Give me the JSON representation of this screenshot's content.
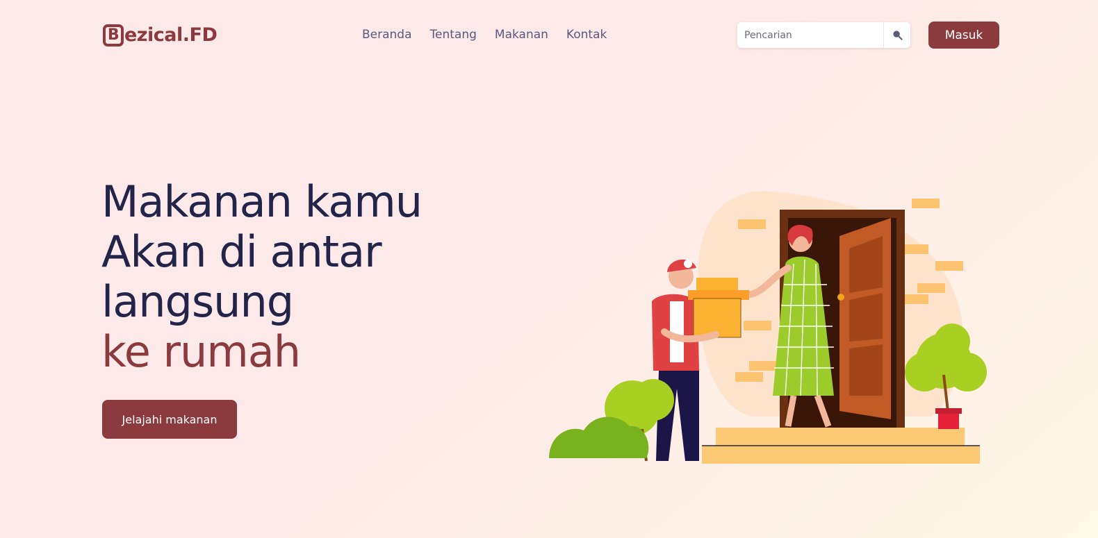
{
  "brand": {
    "logo_letter": "B",
    "logo_rest": "ezical.FD"
  },
  "nav": {
    "items": [
      {
        "label": "Beranda"
      },
      {
        "label": "Tentang"
      },
      {
        "label": "Makanan"
      },
      {
        "label": "Kontak"
      }
    ]
  },
  "search": {
    "placeholder": "Pencarian",
    "icon": "search-icon"
  },
  "login_button": "Masuk",
  "hero": {
    "line1": "Makanan kamu",
    "line2": "Akan di antar",
    "line3": "langsung",
    "line4": "ke rumah",
    "cta": "Jelajahi makanan"
  },
  "colors": {
    "primary": "#8b3a3e",
    "heading": "#22244a",
    "nav_text": "#5a5a7a"
  }
}
